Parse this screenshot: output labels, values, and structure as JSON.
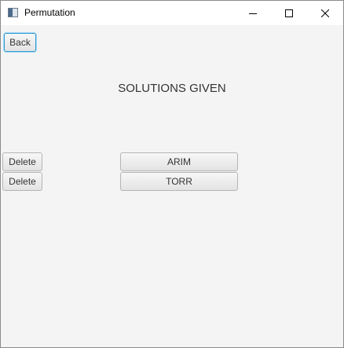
{
  "window": {
    "title": "Permutation"
  },
  "toolbar": {
    "back_label": "Back"
  },
  "main": {
    "heading": "SOLUTIONS GIVEN",
    "solutions": [
      {
        "delete_label": "Delete",
        "value": "ARIM"
      },
      {
        "delete_label": "Delete",
        "value": "TORR"
      }
    ]
  },
  "icons": {
    "app": "app-window-icon",
    "minimize": "minimize-icon",
    "maximize": "maximize-icon",
    "close": "close-icon"
  },
  "colors": {
    "background": "#f4f4f4",
    "focus_border": "#2e9bd6",
    "text": "#333333"
  }
}
